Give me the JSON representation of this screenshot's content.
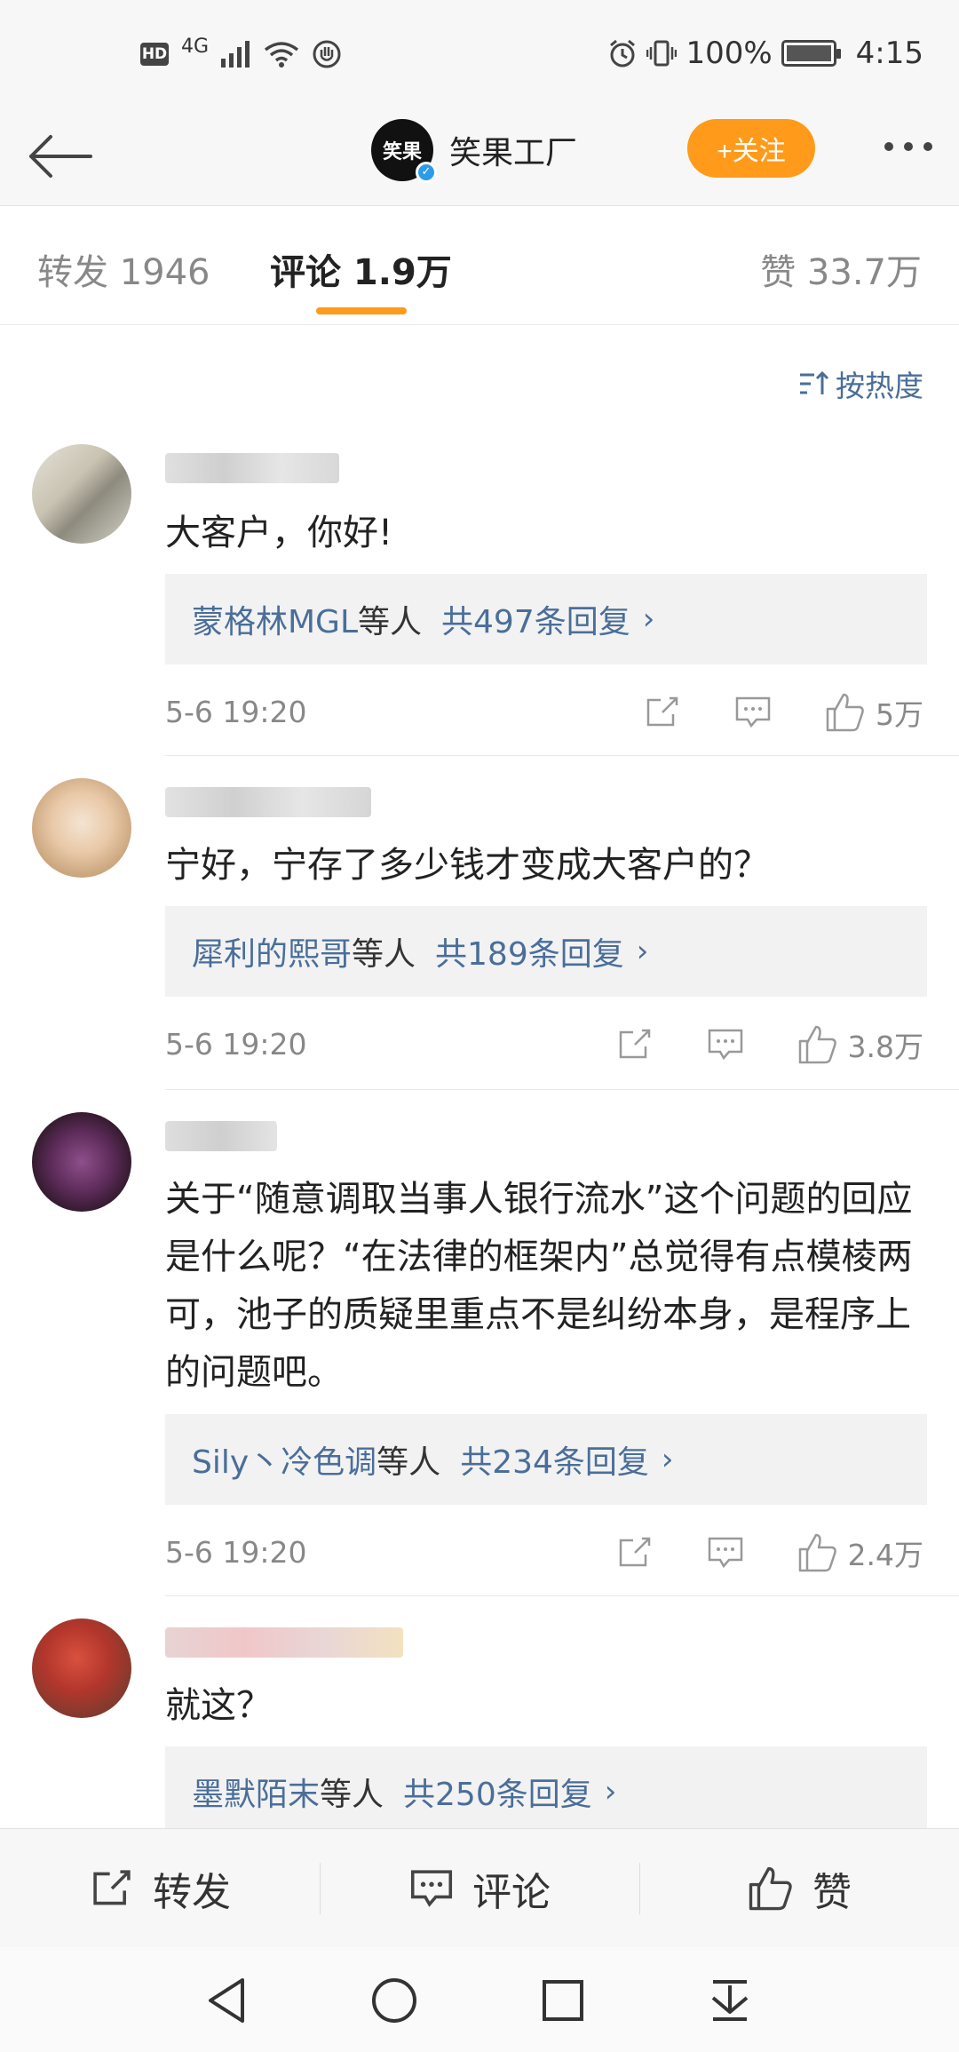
{
  "status_bar": {
    "hd": "HD",
    "network": "4G",
    "battery_text": "100%",
    "battery_level": 1.0,
    "time": "4:15"
  },
  "header": {
    "logo_text": "笑果",
    "account_name": "笑果工厂",
    "follow_label": "+关注",
    "follow_color": "#ff9a1a"
  },
  "tabs": [
    {
      "label": "转发 1946",
      "active": false
    },
    {
      "label": "评论 1.9万",
      "active": true
    },
    {
      "label": "赞 33.7万",
      "active": false
    }
  ],
  "sort": {
    "label": "按热度"
  },
  "comments": [
    {
      "text": "大客户，你好!",
      "reply_names": "蒙格林MGL",
      "reply_by": "等人",
      "reply_count": "共497条回复",
      "time": "5-6 19:20",
      "likes": "5万"
    },
    {
      "text": "宁好，宁存了多少钱才变成大客户的？",
      "reply_names": "犀利的熙哥",
      "reply_by": "等人",
      "reply_count": "共189条回复",
      "time": "5-6 19:20",
      "likes": "3.8万"
    },
    {
      "text": "关于“随意调取当事人银行流水”这个问题的回应是什么呢？“在法律的框架内”总觉得有点模棱两可，池子的质疑里重点不是纠纷本身，是程序上的问题吧。",
      "reply_names": "Sily丶冷色调",
      "reply_by": "等人",
      "reply_count": "共234条回复",
      "time": "5-6 19:20",
      "likes": "2.4万"
    },
    {
      "text": "就这？",
      "reply_names": "墨默陌末",
      "reply_by": "等人",
      "reply_count": "共250条回复"
    }
  ],
  "bottom_bar": {
    "repost": "转发",
    "comment": "评论",
    "like": "赞"
  },
  "colors": {
    "accent": "#ff9a1a",
    "link": "#4a6e99",
    "verified": "#2c9ce8"
  }
}
